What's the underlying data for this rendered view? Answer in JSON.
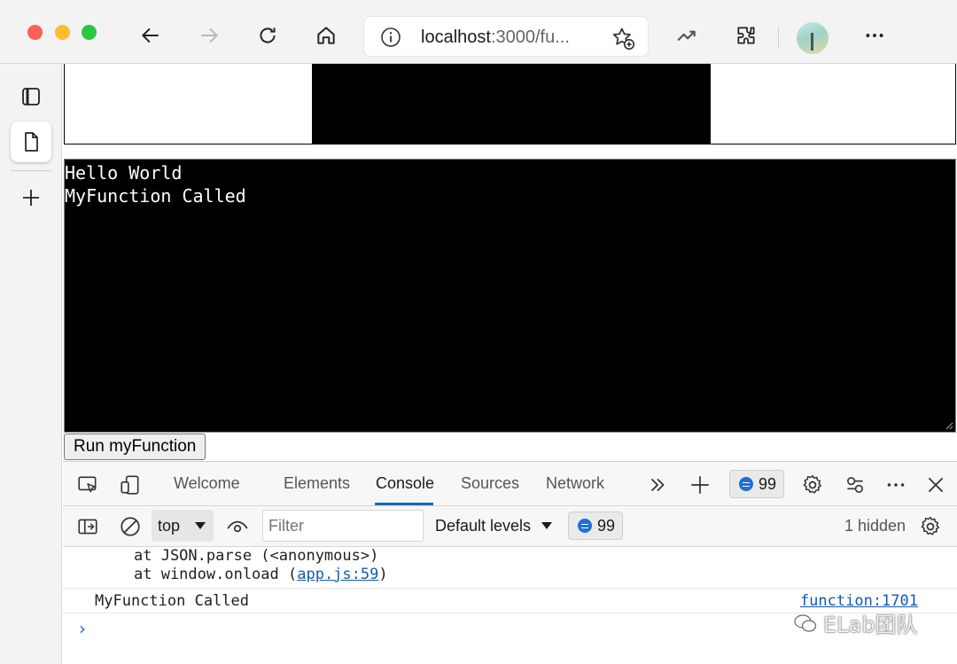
{
  "browser": {
    "address": {
      "host": "localhost",
      "rest": ":3000/fu..."
    },
    "icons": [
      "back-icon",
      "forward-icon",
      "refresh-icon",
      "home-icon",
      "info-icon",
      "favorite-add-icon",
      "performance-icon",
      "extensions-icon",
      "profile-avatar",
      "more-icon"
    ],
    "colors": {
      "close": "#fe5f57",
      "minimize": "#febc2e",
      "maximize": "#28c840"
    }
  },
  "sidebar": {
    "icons": [
      "tab-actions-icon",
      "page-tab-icon",
      "new-tab-icon"
    ]
  },
  "page": {
    "output_lines": [
      "Hello World",
      "MyFunction Called"
    ],
    "run_button": "Run myFunction"
  },
  "devtools": {
    "tabs": [
      "Welcome",
      "Elements",
      "Console",
      "Sources",
      "Network"
    ],
    "active_tab": "Console",
    "issues_count": "99",
    "toolbar": {
      "context": "top",
      "filter_placeholder": "Filter",
      "levels": "Default levels",
      "message_count": "99",
      "hidden": "1 hidden"
    },
    "console": {
      "stack_line1": "at JSON.parse (<anonymous>)",
      "stack_line2_prefix": "at window.onload (",
      "stack_line2_link": "app.js:59",
      "stack_line2_suffix": ")",
      "message": "MyFunction Called",
      "message_source": "function:1701",
      "prompt": "›"
    },
    "accent": "#0f6cbd"
  },
  "watermark": "ELab团队"
}
